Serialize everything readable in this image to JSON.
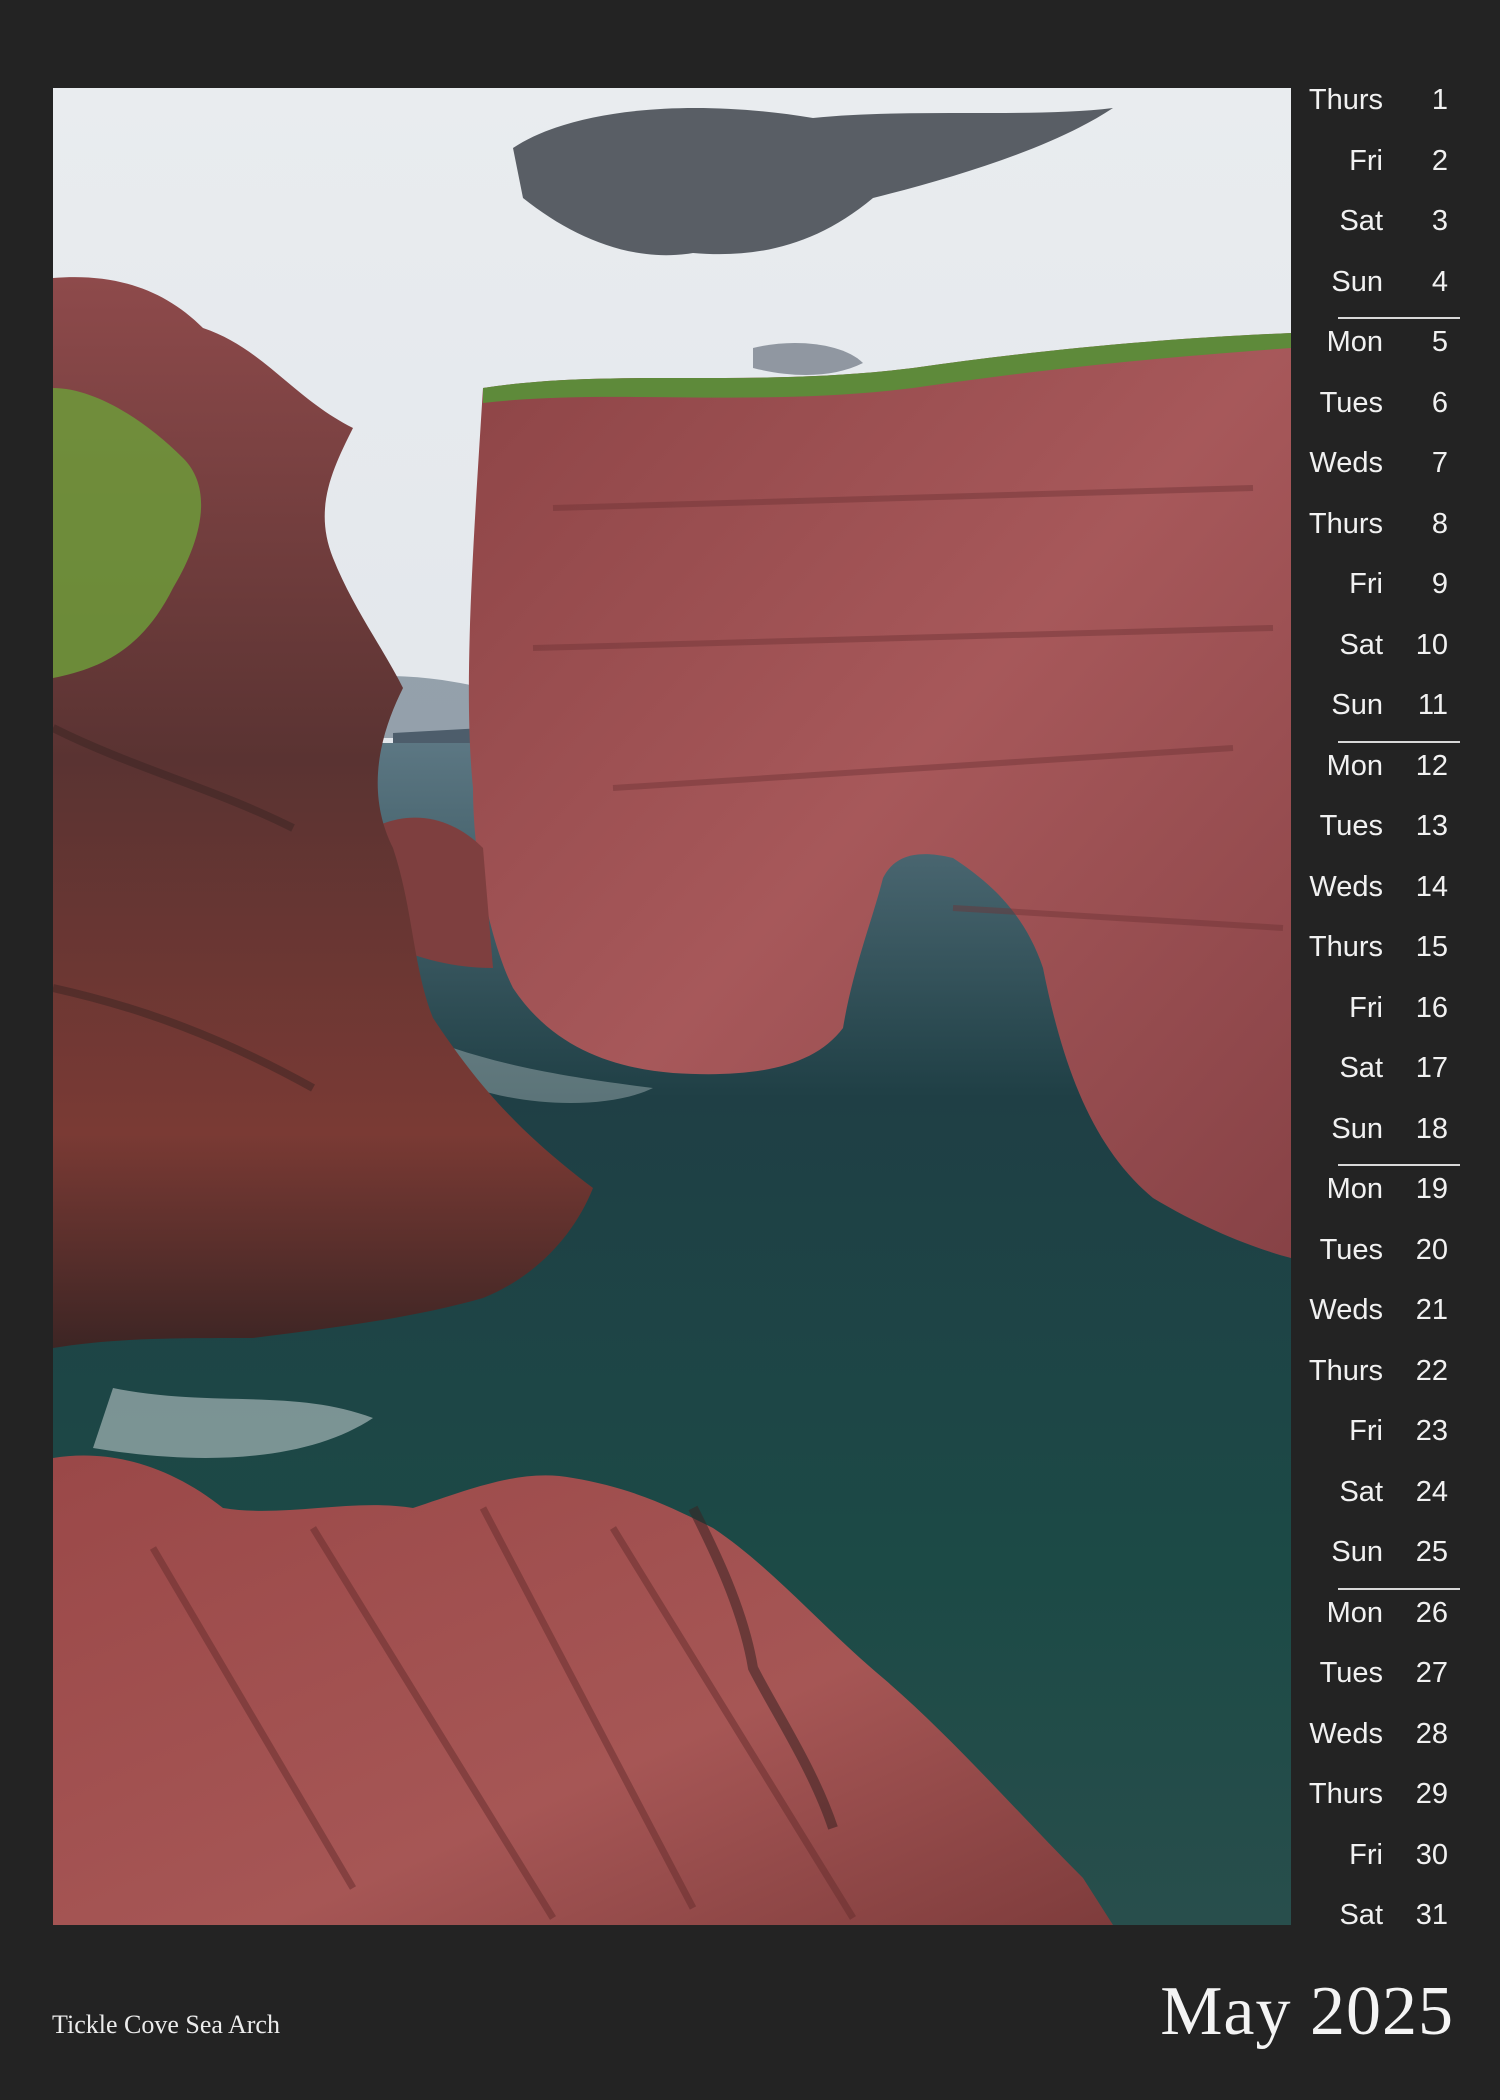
{
  "calendar": {
    "month_title": "May 2025",
    "photo_caption": "Tickle Cove Sea Arch",
    "days": [
      {
        "name": "Thurs",
        "num": "1"
      },
      {
        "name": "Fri",
        "num": "2"
      },
      {
        "name": "Sat",
        "num": "3"
      },
      {
        "name": "Sun",
        "num": "4"
      },
      {
        "name": "Mon",
        "num": "5"
      },
      {
        "name": "Tues",
        "num": "6"
      },
      {
        "name": "Weds",
        "num": "7"
      },
      {
        "name": "Thurs",
        "num": "8"
      },
      {
        "name": "Fri",
        "num": "9"
      },
      {
        "name": "Sat",
        "num": "10"
      },
      {
        "name": "Sun",
        "num": "11"
      },
      {
        "name": "Mon",
        "num": "12"
      },
      {
        "name": "Tues",
        "num": "13"
      },
      {
        "name": "Weds",
        "num": "14"
      },
      {
        "name": "Thurs",
        "num": "15"
      },
      {
        "name": "Fri",
        "num": "16"
      },
      {
        "name": "Sat",
        "num": "17"
      },
      {
        "name": "Sun",
        "num": "18"
      },
      {
        "name": "Mon",
        "num": "19"
      },
      {
        "name": "Tues",
        "num": "20"
      },
      {
        "name": "Weds",
        "num": "21"
      },
      {
        "name": "Thurs",
        "num": "22"
      },
      {
        "name": "Fri",
        "num": "23"
      },
      {
        "name": "Sat",
        "num": "24"
      },
      {
        "name": "Sun",
        "num": "25"
      },
      {
        "name": "Mon",
        "num": "26"
      },
      {
        "name": "Tues",
        "num": "27"
      },
      {
        "name": "Weds",
        "num": "28"
      },
      {
        "name": "Thurs",
        "num": "29"
      },
      {
        "name": "Fri",
        "num": "30"
      },
      {
        "name": "Sat",
        "num": "31"
      }
    ]
  },
  "colors": {
    "background": "#232323",
    "text": "#f1f1f1",
    "rock": "#9a4b4e",
    "water": "#1f4a4a"
  }
}
